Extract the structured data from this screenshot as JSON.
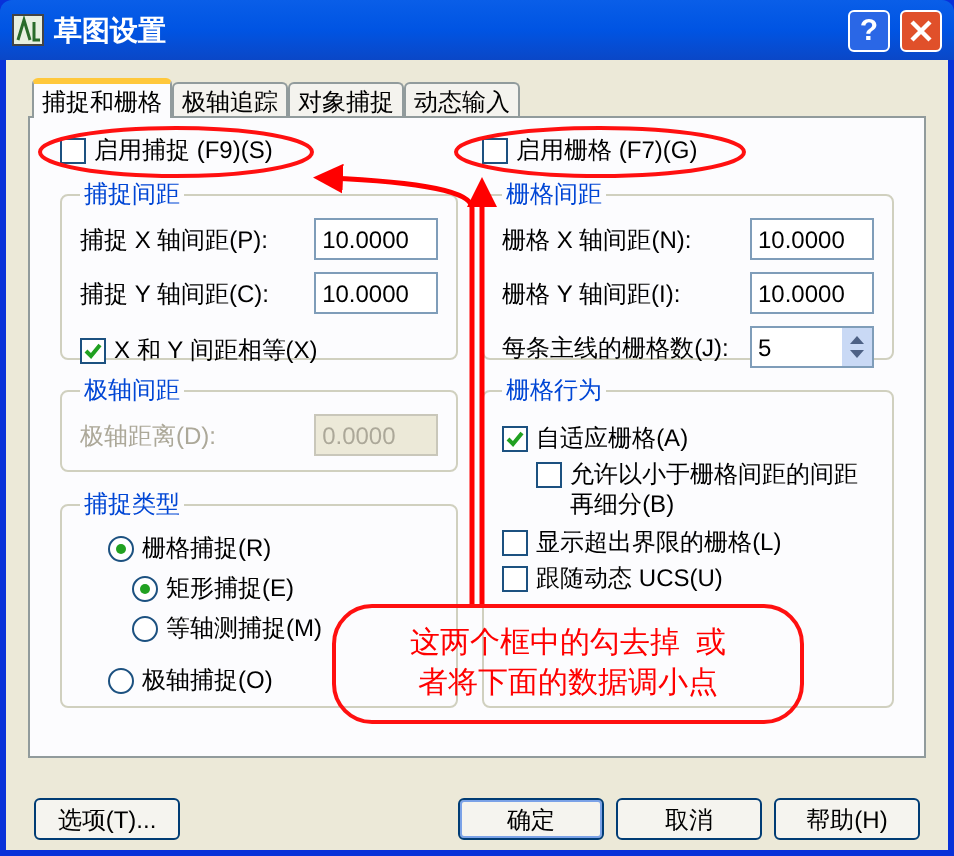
{
  "window": {
    "title": "草图设置",
    "help_button": "?"
  },
  "tabs": [
    {
      "label": "捕捉和栅格",
      "selected": true
    },
    {
      "label": "极轴追踪",
      "selected": false
    },
    {
      "label": "对象捕捉",
      "selected": false
    },
    {
      "label": "动态输入",
      "selected": false
    }
  ],
  "snap": {
    "enable": {
      "label": "启用捕捉 (F9)(S)",
      "checked": false
    },
    "spacing": {
      "title": "捕捉间距",
      "fields": [
        {
          "label": "捕捉 X 轴间距(P):",
          "value": "10.0000",
          "kind": "text"
        },
        {
          "label": "捕捉 Y 轴间距(C):",
          "value": "10.0000",
          "kind": "text"
        }
      ],
      "equal": {
        "label": "X 和 Y 间距相等(X)",
        "checked": true
      }
    },
    "polar": {
      "title": "极轴间距",
      "label": "极轴距离(D):",
      "value": "0.0000",
      "disabled": true
    },
    "type": {
      "title": "捕捉类型",
      "options": [
        {
          "label": "栅格捕捉(R)",
          "selected": true,
          "children": [
            {
              "label": "矩形捕捉(E)",
              "selected": true
            },
            {
              "label": "等轴测捕捉(M)",
              "selected": false
            }
          ]
        },
        {
          "label": "极轴捕捉(O)",
          "selected": false
        }
      ]
    }
  },
  "grid": {
    "enable": {
      "label": "启用栅格 (F7)(G)",
      "checked": false
    },
    "spacing": {
      "title": "栅格间距",
      "fields": [
        {
          "label": "栅格 X 轴间距(N):",
          "value": "10.0000",
          "kind": "text"
        },
        {
          "label": "栅格 Y 轴间距(I):",
          "value": "10.0000",
          "kind": "text"
        },
        {
          "label": "每条主线的栅格数(J):",
          "value": "5",
          "kind": "spin"
        }
      ]
    },
    "behavior": {
      "title": "栅格行为",
      "options": [
        {
          "label": "自适应栅格(A)",
          "checked": true,
          "children": [
            {
              "label": "允许以小于栅格间距的间距再细分(B)",
              "checked": false
            }
          ]
        },
        {
          "label": "显示超出界限的栅格(L)",
          "checked": false
        },
        {
          "label": "跟随动态 UCS(U)",
          "checked": false
        }
      ]
    }
  },
  "buttons_left": [
    {
      "label": "选项(T)...",
      "default": false
    }
  ],
  "buttons_right": [
    {
      "label": "确定",
      "default": true
    },
    {
      "label": "取消",
      "default": false
    },
    {
      "label": "帮助(H)",
      "default": false
    }
  ],
  "annotation": {
    "lines": [
      "这两个框中的勾去掉  或",
      "者将下面的数据调小点"
    ]
  }
}
